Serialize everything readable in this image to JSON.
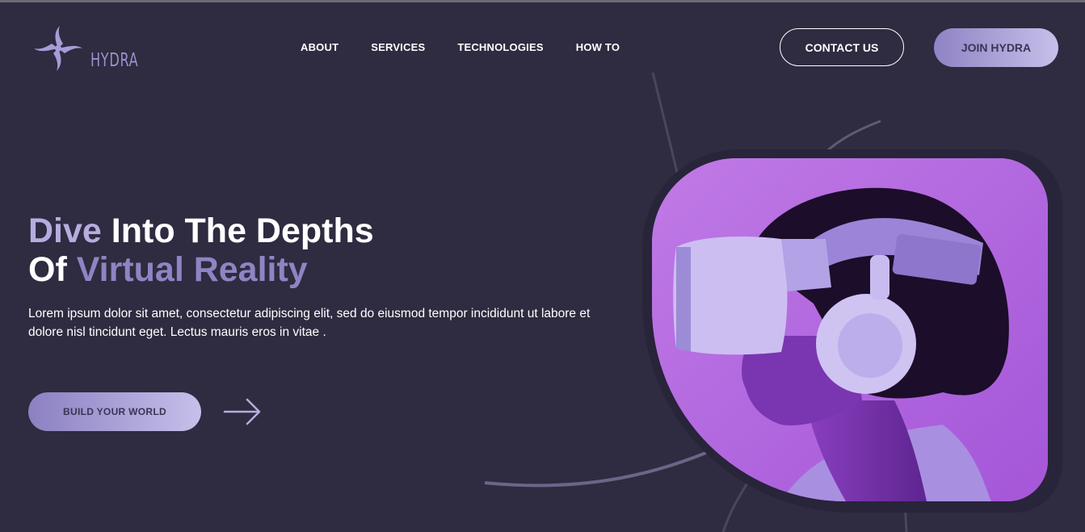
{
  "brand": {
    "name": "HYDRA"
  },
  "nav": {
    "items": [
      "ABOUT",
      "SERVICES",
      "TECHNOLOGIES",
      "HOW TO"
    ]
  },
  "header": {
    "contact_label": "CONTACT US",
    "join_label": "JOIN HYDRA"
  },
  "hero": {
    "title_word1": "Dive",
    "title_rest1": " Into The Depths",
    "title_word2": "Of",
    "title_rest2": " Virtual Reality",
    "description": "Lorem ipsum dolor sit amet, consectetur adipiscing elit, sed do eiusmod tempor incididunt ut labore et dolore nisl tincidunt eget. Lectus mauris eros in vitae .",
    "cta_label": "BUILD YOUR WORLD"
  },
  "icons": {
    "logo": "hydra-swirl-logo",
    "cta_arrow": "arrow-right-icon"
  },
  "colors": {
    "background": "#2f2b40",
    "accent": "#b6acdf",
    "photo_bg": "#b267dc"
  }
}
